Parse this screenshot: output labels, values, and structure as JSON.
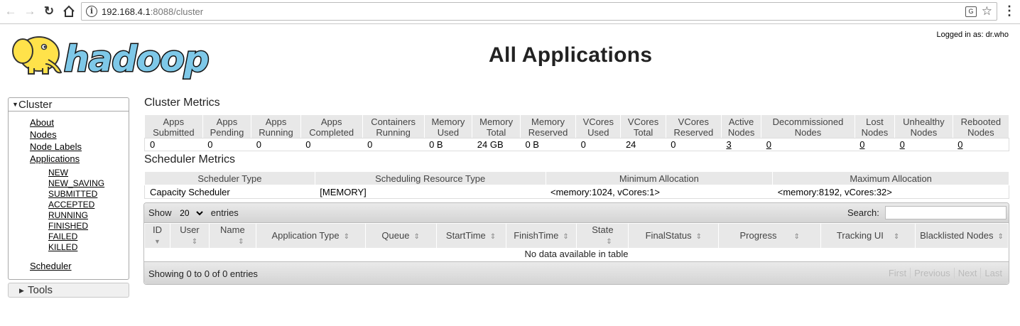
{
  "browser": {
    "url_host": "192.168.4.1",
    "url_rest": ":8088/cluster",
    "back_icon": "back-arrow-icon",
    "forward_icon": "forward-arrow-icon",
    "reload_icon": "reload-icon",
    "home_icon": "home-icon"
  },
  "header": {
    "logo_text": "hadoop",
    "title": "All Applications",
    "logged_in": "Logged in as: dr.who"
  },
  "sidebar": {
    "cluster_label": "Cluster",
    "links": [
      "About",
      "Nodes",
      "Node Labels",
      "Applications"
    ],
    "app_states": [
      "NEW",
      "NEW_SAVING",
      "SUBMITTED",
      "ACCEPTED",
      "RUNNING",
      "FINISHED",
      "FAILED",
      "KILLED"
    ],
    "scheduler": "Scheduler",
    "tools_label": "Tools"
  },
  "cluster_metrics": {
    "title": "Cluster Metrics",
    "headers": [
      [
        "Apps",
        "Submitted"
      ],
      [
        "Apps",
        "Pending"
      ],
      [
        "Apps",
        "Running"
      ],
      [
        "Apps",
        "Completed"
      ],
      [
        "Containers",
        "Running"
      ],
      [
        "Memory",
        "Used"
      ],
      [
        "Memory",
        "Total"
      ],
      [
        "Memory",
        "Reserved"
      ],
      [
        "VCores",
        "Used"
      ],
      [
        "VCores",
        "Total"
      ],
      [
        "VCores",
        "Reserved"
      ],
      [
        "Active",
        "Nodes"
      ],
      [
        "Decommissioned",
        "Nodes"
      ],
      [
        "Lost",
        "Nodes"
      ],
      [
        "Unhealthy",
        "Nodes"
      ],
      [
        "Rebooted",
        "Nodes"
      ]
    ],
    "values": [
      "0",
      "0",
      "0",
      "0",
      "0",
      "0 B",
      "24 GB",
      "0 B",
      "0",
      "24",
      "0",
      "3",
      "0",
      "0",
      "0",
      "0"
    ]
  },
  "scheduler_metrics": {
    "title": "Scheduler Metrics",
    "headers": [
      "Scheduler Type",
      "Scheduling Resource Type",
      "Minimum Allocation",
      "Maximum Allocation"
    ],
    "values": [
      "Capacity Scheduler",
      "[MEMORY]",
      "<memory:1024, vCores:1>",
      "<memory:8192, vCores:32>"
    ]
  },
  "apps_table": {
    "show_label": "Show",
    "entries_value": "20",
    "entries_label": "entries",
    "search_label": "Search:",
    "columns": [
      "ID",
      "User",
      "Name",
      "Application Type",
      "Queue",
      "StartTime",
      "FinishTime",
      "State",
      "FinalStatus",
      "Progress",
      "Tracking UI",
      "Blacklisted Nodes"
    ],
    "empty_message": "No data available in table",
    "showing": "Showing 0 to 0 of 0 entries",
    "pager": [
      "First",
      "Previous",
      "Next",
      "Last"
    ]
  }
}
